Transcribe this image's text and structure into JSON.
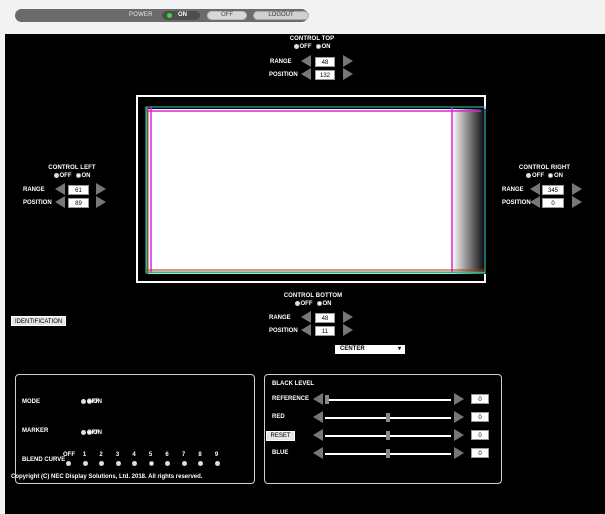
{
  "header": {
    "power_label": "POWER",
    "on_label": "ON",
    "off_label": "OFF",
    "logout_label": "LOGOUT"
  },
  "radio": {
    "off": "OFF",
    "on": "ON"
  },
  "labels": {
    "range": "RANGE",
    "position": "POSITION"
  },
  "control_top": {
    "title": "CONTROL TOP",
    "selected": "on",
    "range": "48",
    "position": "132"
  },
  "control_left": {
    "title": "CONTROL LEFT",
    "selected": "on",
    "range": "61",
    "position": "89"
  },
  "control_right": {
    "title": "CONTROL RIGHT",
    "selected": "on",
    "range": "345",
    "position": "0"
  },
  "control_bottom": {
    "title": "CONTROL BOTTOM",
    "selected": "on",
    "range": "48",
    "position": "11"
  },
  "preview": {
    "guide_colors": {
      "cyan": "#33cccc",
      "magenta": "#dd22dd",
      "red": "#cc2222",
      "green": "#22aa44"
    }
  },
  "identification_button": "IDENTIFICATION",
  "settings": {
    "mode": {
      "label": "MODE",
      "selected": "on"
    },
    "marker": {
      "label": "MARKER",
      "selected": "on"
    },
    "blend_curve": {
      "label": "BLEND CURVE",
      "options": [
        "OFF",
        "1",
        "2",
        "3",
        "4",
        "5",
        "6",
        "7",
        "8",
        "9"
      ],
      "selected": "5"
    }
  },
  "black_level": {
    "label": "BLACK LEVEL",
    "select_value": "CENTER",
    "sliders": [
      {
        "label": "REFERENCE",
        "value": "0",
        "fill": 0.0
      },
      {
        "label": "RED",
        "value": "0",
        "fill": 0.5
      },
      {
        "label": "GREEN",
        "value": "0",
        "fill": 0.5
      },
      {
        "label": "BLUE",
        "value": "0",
        "fill": 0.5
      }
    ],
    "reset_label": "RESET"
  },
  "footer": {
    "copyright": "Copyright (C) NEC Display Solutions, Ltd. 2018. All rights reserved."
  }
}
